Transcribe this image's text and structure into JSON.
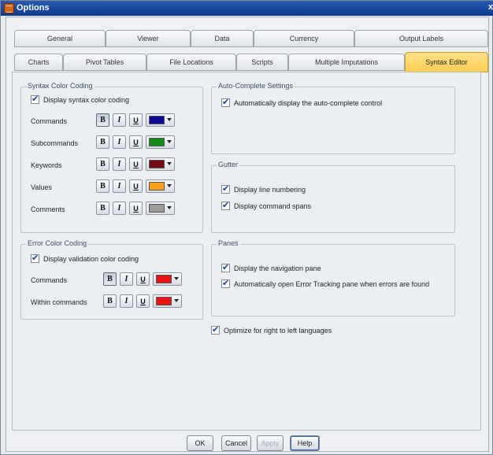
{
  "window": {
    "title": "Options",
    "close_glyph": "x"
  },
  "tabs_row1": [
    "General",
    "Viewer",
    "Data",
    "Currency",
    "Output Labels"
  ],
  "tabs_row2": [
    "Charts",
    "Pivot Tables",
    "File Locations",
    "Scripts",
    "Multiple Imputations",
    "Syntax Editor"
  ],
  "active_tab": "Syntax Editor",
  "syntax_color": {
    "title": "Syntax Color Coding",
    "display_label": "Display syntax color coding",
    "display_checked": true,
    "rows": [
      {
        "label": "Commands",
        "color": "#0a0a96",
        "bold": true
      },
      {
        "label": "Subcommands",
        "color": "#118a1e",
        "bold": false
      },
      {
        "label": "Keywords",
        "color": "#7a0a18",
        "bold": false
      },
      {
        "label": "Values",
        "color": "#f5a018",
        "bold": false
      },
      {
        "label": "Comments",
        "color": "#9a9a9a",
        "bold": false
      }
    ]
  },
  "error_color": {
    "title": "Error Color Coding",
    "display_label": "Display validation color coding",
    "display_checked": true,
    "rows": [
      {
        "label": "Commands",
        "color": "#ee1111",
        "bold": true
      },
      {
        "label": "Within commands",
        "color": "#ee1111",
        "bold": false
      }
    ]
  },
  "format_buttons": {
    "bold": "B",
    "italic": "I",
    "underline": "U"
  },
  "autocomplete": {
    "title": "Auto-Complete Settings",
    "label": "Automatically display the auto-complete control",
    "checked": true
  },
  "gutter": {
    "title": "Gutter",
    "items": [
      {
        "label": "Display line numbering",
        "checked": true
      },
      {
        "label": "Display command spans",
        "checked": true
      }
    ]
  },
  "panes": {
    "title": "Panes",
    "items": [
      {
        "label": "Display the navigation pane",
        "checked": true
      },
      {
        "label": "Automatically open Error Tracking pane when errors are found",
        "checked": true
      }
    ]
  },
  "rtl": {
    "label": "Optimize for right to left languages",
    "checked": true
  },
  "buttons": {
    "ok": "OK",
    "cancel": "Cancel",
    "apply": "Apply",
    "help": "Help"
  },
  "icons": {
    "app": "options-app-icon",
    "check": "checkmark-icon",
    "dropdown": "chevron-down-icon"
  }
}
